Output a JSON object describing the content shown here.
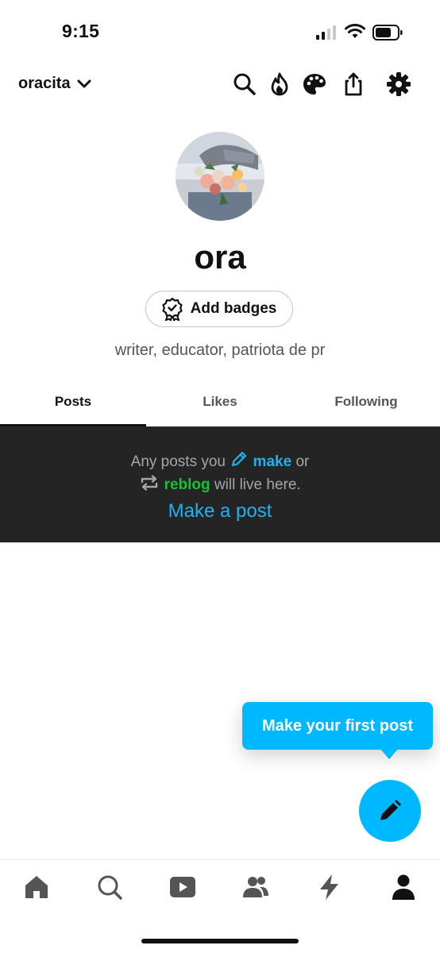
{
  "status_bar": {
    "time": "9:15"
  },
  "top_bar": {
    "blog_name": "oracita",
    "icons": [
      "search-icon",
      "flame-icon",
      "palette-icon",
      "share-icon",
      "settings-icon"
    ]
  },
  "profile": {
    "title": "ora",
    "add_badges_label": "Add badges",
    "description": "writer, educator, patriota de pr"
  },
  "tabs": [
    {
      "label": "Posts",
      "active": true
    },
    {
      "label": "Likes",
      "active": false
    },
    {
      "label": "Following",
      "active": false
    }
  ],
  "empty_state": {
    "line1_prefix": "Any posts you",
    "make_label": "make",
    "line1_suffix": "or",
    "reblog_label": "reblog",
    "line2_suffix": "will live here.",
    "make_post_link": "Make a post"
  },
  "tooltip": {
    "text": "Make your first post"
  },
  "bottom_nav": {
    "items": [
      "home-icon",
      "explore-icon",
      "video-icon",
      "communities-icon",
      "activity-icon",
      "account-icon"
    ]
  },
  "colors": {
    "accent_blue": "#00b8ff",
    "link_blue": "#1fb2f2",
    "reblog_green": "#1dbf3a",
    "panel_bg": "#242424"
  }
}
